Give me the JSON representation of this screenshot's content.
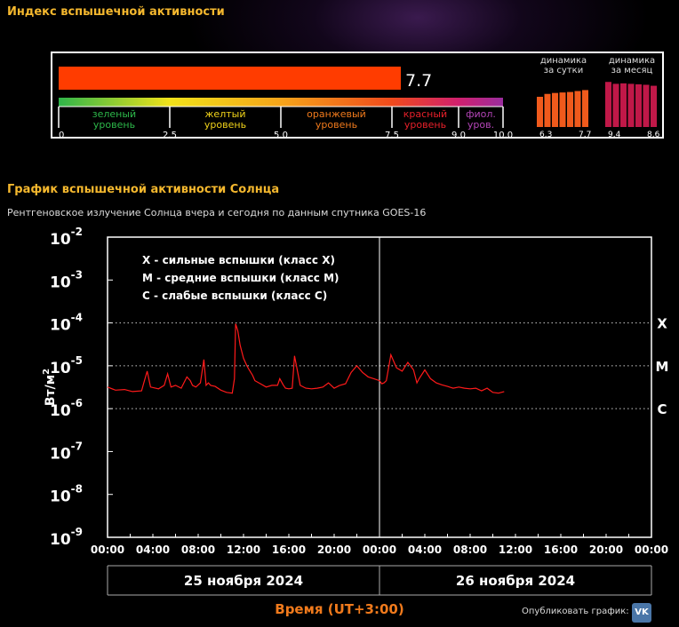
{
  "header": {
    "title": "Индекс вспышечной активности",
    "index_value": "7.7",
    "scale_labels": [
      "0",
      "2.5",
      "5.0",
      "7.5",
      "9.0",
      "10.0"
    ],
    "levels": [
      {
        "line1": "зеленый",
        "line2": "уровень",
        "color": "#2db84a"
      },
      {
        "line1": "желтый",
        "line2": "уровень",
        "color": "#f1d31a"
      },
      {
        "line1": "оранжевый",
        "line2": "уровень",
        "color": "#f07a1c"
      },
      {
        "line1": "красный",
        "line2": "уровень",
        "color": "#e8202a"
      },
      {
        "line1": "фиол.",
        "line2": "уров.",
        "color": "#b445b8"
      }
    ],
    "daily": {
      "title1": "динамика",
      "title2": "за сутки",
      "min_label": "6.3",
      "max_label": "7.7",
      "values": [
        6.3,
        6.9,
        7.1,
        7.2,
        7.3,
        7.5,
        7.7
      ]
    },
    "monthly": {
      "title1": "динамика",
      "title2": "за месяц",
      "min_label": "9.4",
      "max_label": "8.6",
      "values": [
        9.4,
        9.0,
        9.1,
        9.0,
        8.9,
        8.8,
        8.6
      ]
    }
  },
  "section": {
    "title": "График вспышечной активности Солнца",
    "subtitle": "Рентгеновское излучение Солнца вчера и сегодня по данным спутника GOES-16"
  },
  "chart_data": {
    "type": "line",
    "ylabel_base": "Вт/м",
    "ylabel_sup": "2",
    "xlabel": "Время (UT+3:00)",
    "y_scale": "log",
    "ylim": [
      1e-09,
      0.01
    ],
    "xlim_hours": [
      0,
      48
    ],
    "y_ticks": [
      {
        "base": "10",
        "exp": "-2"
      },
      {
        "base": "10",
        "exp": "-3"
      },
      {
        "base": "10",
        "exp": "-4"
      },
      {
        "base": "10",
        "exp": "-5"
      },
      {
        "base": "10",
        "exp": "-6"
      },
      {
        "base": "10",
        "exp": "-7"
      },
      {
        "base": "10",
        "exp": "-8"
      },
      {
        "base": "10",
        "exp": "-9"
      }
    ],
    "x_tick_labels": [
      "00:00",
      "04:00",
      "08:00",
      "12:00",
      "16:00",
      "20:00",
      "00:00",
      "04:00",
      "08:00",
      "12:00",
      "16:00",
      "20:00",
      "00:00"
    ],
    "days": [
      "25 ноября 2024",
      "26 ноября 2024"
    ],
    "class_lines": [
      {
        "label": "X",
        "value": 0.0001
      },
      {
        "label": "M",
        "value": 1e-05
      },
      {
        "label": "C",
        "value": 1e-06
      }
    ],
    "legend": [
      "X  - сильные вспышки (класс X)",
      "M  - средние вспышки (класс M)",
      "C  - слабые вспышки (класс C)"
    ],
    "series": [
      {
        "color": "#ff1a1a",
        "x_hours": [
          0,
          0.7,
          1.5,
          2.2,
          3.0,
          3.2,
          3.5,
          3.8,
          4.5,
          5.0,
          5.3,
          5.6,
          6.0,
          6.5,
          7.0,
          7.3,
          7.5,
          7.8,
          8.2,
          8.5,
          8.7,
          8.9,
          9.1,
          9.5,
          10.0,
          10.5,
          11.0,
          11.2,
          11.3,
          11.5,
          11.7,
          12.0,
          12.3,
          12.5,
          12.8,
          13.0,
          13.5,
          14.0,
          14.5,
          15.0,
          15.2,
          15.5,
          15.7,
          16.0,
          16.3,
          16.5,
          17.0,
          17.5,
          18.0,
          18.5,
          19.0,
          19.5,
          20.0,
          20.5,
          21.0,
          21.5,
          22.0,
          22.5,
          23.0,
          23.5,
          24.0,
          24.2,
          24.4,
          24.6,
          25.0,
          25.5,
          26.0,
          26.5,
          27.0,
          27.3,
          27.5,
          28.0,
          28.5,
          29.0,
          29.5,
          30.0,
          30.5,
          31.0,
          31.5,
          32.0,
          32.5,
          33.0,
          33.5,
          34.0,
          34.5,
          35.0
        ],
        "y_values": [
          3.2e-06,
          2.7e-06,
          2.8e-06,
          2.5e-06,
          2.6e-06,
          4e-06,
          7.5e-06,
          3.2e-06,
          2.9e-06,
          3.5e-06,
          6.5e-06,
          3.2e-06,
          3.5e-06,
          3e-06,
          5.5e-06,
          4.5e-06,
          3.5e-06,
          3.2e-06,
          4e-06,
          1.4e-05,
          3.5e-06,
          4e-06,
          3.5e-06,
          3.3e-06,
          2.7e-06,
          2.4e-06,
          2.3e-06,
          5e-06,
          9.5e-05,
          6.5e-05,
          3e-05,
          1.5e-05,
          1e-05,
          8e-06,
          6e-06,
          4.5e-06,
          3.8e-06,
          3.2e-06,
          3.5e-06,
          3.5e-06,
          5e-06,
          3.6e-06,
          3e-06,
          2.9e-06,
          3e-06,
          1.7e-05,
          3.5e-06,
          3e-06,
          2.9e-06,
          3e-06,
          3.2e-06,
          4e-06,
          3e-06,
          3.5e-06,
          3.8e-06,
          7e-06,
          1e-05,
          7e-06,
          5.5e-06,
          5e-06,
          4.5e-06,
          3.8e-06,
          4e-06,
          4.5e-06,
          1.8e-05,
          9e-06,
          7.5e-06,
          1.2e-05,
          8e-06,
          4e-06,
          5e-06,
          8e-06,
          5e-06,
          4e-06,
          3.6e-06,
          3.3e-06,
          3e-06,
          3.2e-06,
          3e-06,
          2.9e-06,
          3e-06,
          2.6e-06,
          3e-06,
          2.4e-06,
          2.3e-06,
          2.5e-06
        ]
      }
    ]
  },
  "footer": {
    "share_label": "Опубликовать график:",
    "vk_label": "VK"
  }
}
